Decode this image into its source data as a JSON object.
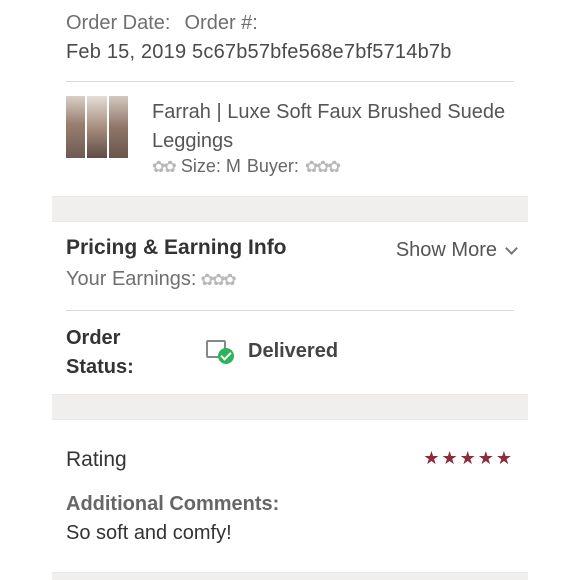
{
  "order": {
    "date_label": "Order Date:",
    "number_label": "Order #:",
    "date_value": "Feb 15, 2019",
    "number_value": "5c67b57bfe568e7bf5714b7b"
  },
  "item": {
    "title": "Farrah | Luxe Soft Faux Brushed Suede Leggings",
    "size": "Size: M",
    "buyer_label": "Buyer:"
  },
  "pricing": {
    "title": "Pricing & Earning Info",
    "show_more": "Show More",
    "earnings_label": "Your Earnings:"
  },
  "status": {
    "label": "Order Status:",
    "value": "Delivered"
  },
  "rating": {
    "title": "Rating",
    "stars": 5,
    "stars_display": "★★★★★",
    "comments_label": "Additional Comments:",
    "comments": "So soft and comfy!"
  },
  "colors": {
    "star": "#8e2a3a",
    "check": "#2eb35a",
    "band": "#f1efed"
  },
  "icons": {
    "status_icon": "package-delivered-check-icon",
    "chevron": "chevron-down-icon",
    "redaction": "flower-sticker-icon"
  }
}
